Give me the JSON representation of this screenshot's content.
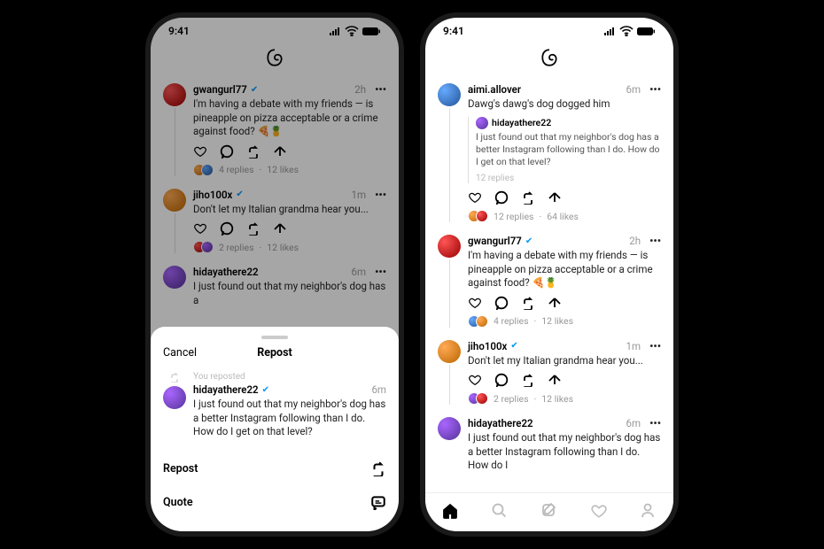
{
  "status": {
    "time": "9:41",
    "signal": "▪▮▮▮",
    "wifi": "wifi",
    "battery": "battery"
  },
  "leftPhone": {
    "feed": [
      {
        "username": "gwangurl77",
        "verified": true,
        "time": "2h",
        "text": "I'm having a debate with my friends — is pineapple on pizza acceptable or a crime against food? 🍕🍍",
        "replies": "4 replies",
        "likes": "12 likes",
        "avatar": "red"
      },
      {
        "username": "jiho100x",
        "verified": true,
        "time": "1m",
        "text": "Don't let my Italian grandma hear you...",
        "replies": "2 replies",
        "likes": "12 likes",
        "avatar": "orange"
      },
      {
        "username": "hidayathere22",
        "verified": false,
        "time": "6m",
        "text": "I just found out that my neighbor's dog has a",
        "avatar": "purple"
      }
    ],
    "sheet": {
      "cancel": "Cancel",
      "title": "Repost",
      "youReposted": "You reposted",
      "post": {
        "username": "hidayathere22",
        "verified": true,
        "time": "6m",
        "text": "I just found out that my neighbor's dog has a better Instagram following than I do. How do I get on that level?",
        "avatar": "purple"
      },
      "actions": {
        "repost": "Repost",
        "quote": "Quote"
      }
    }
  },
  "rightPhone": {
    "feed": [
      {
        "username": "aimi.allover",
        "verified": false,
        "time": "6m",
        "text": "Dawg's dawg's dog dogged him",
        "avatar": "blue",
        "quoted": {
          "username": "hidayathere22",
          "text": "I just found out that my neighbor's dog has a better Instagram following than I do. How do I get on that level?",
          "replies": "12 replies",
          "avatar": "purple"
        },
        "replies": "12 replies",
        "likes": "64 likes"
      },
      {
        "username": "gwangurl77",
        "verified": true,
        "time": "2h",
        "text": "I'm having a debate with my friends — is pineapple on pizza acceptable or a crime against food? 🍕🍍",
        "replies": "4 replies",
        "likes": "12 likes",
        "avatar": "red"
      },
      {
        "username": "jiho100x",
        "verified": true,
        "time": "1m",
        "text": "Don't let my Italian grandma hear you...",
        "replies": "2 replies",
        "likes": "12 likes",
        "avatar": "orange"
      },
      {
        "username": "hidayathere22",
        "verified": false,
        "time": "6m",
        "text": "I just found out that my neighbor's dog has a better Instagram following than I do. How do I",
        "avatar": "purple"
      }
    ]
  }
}
